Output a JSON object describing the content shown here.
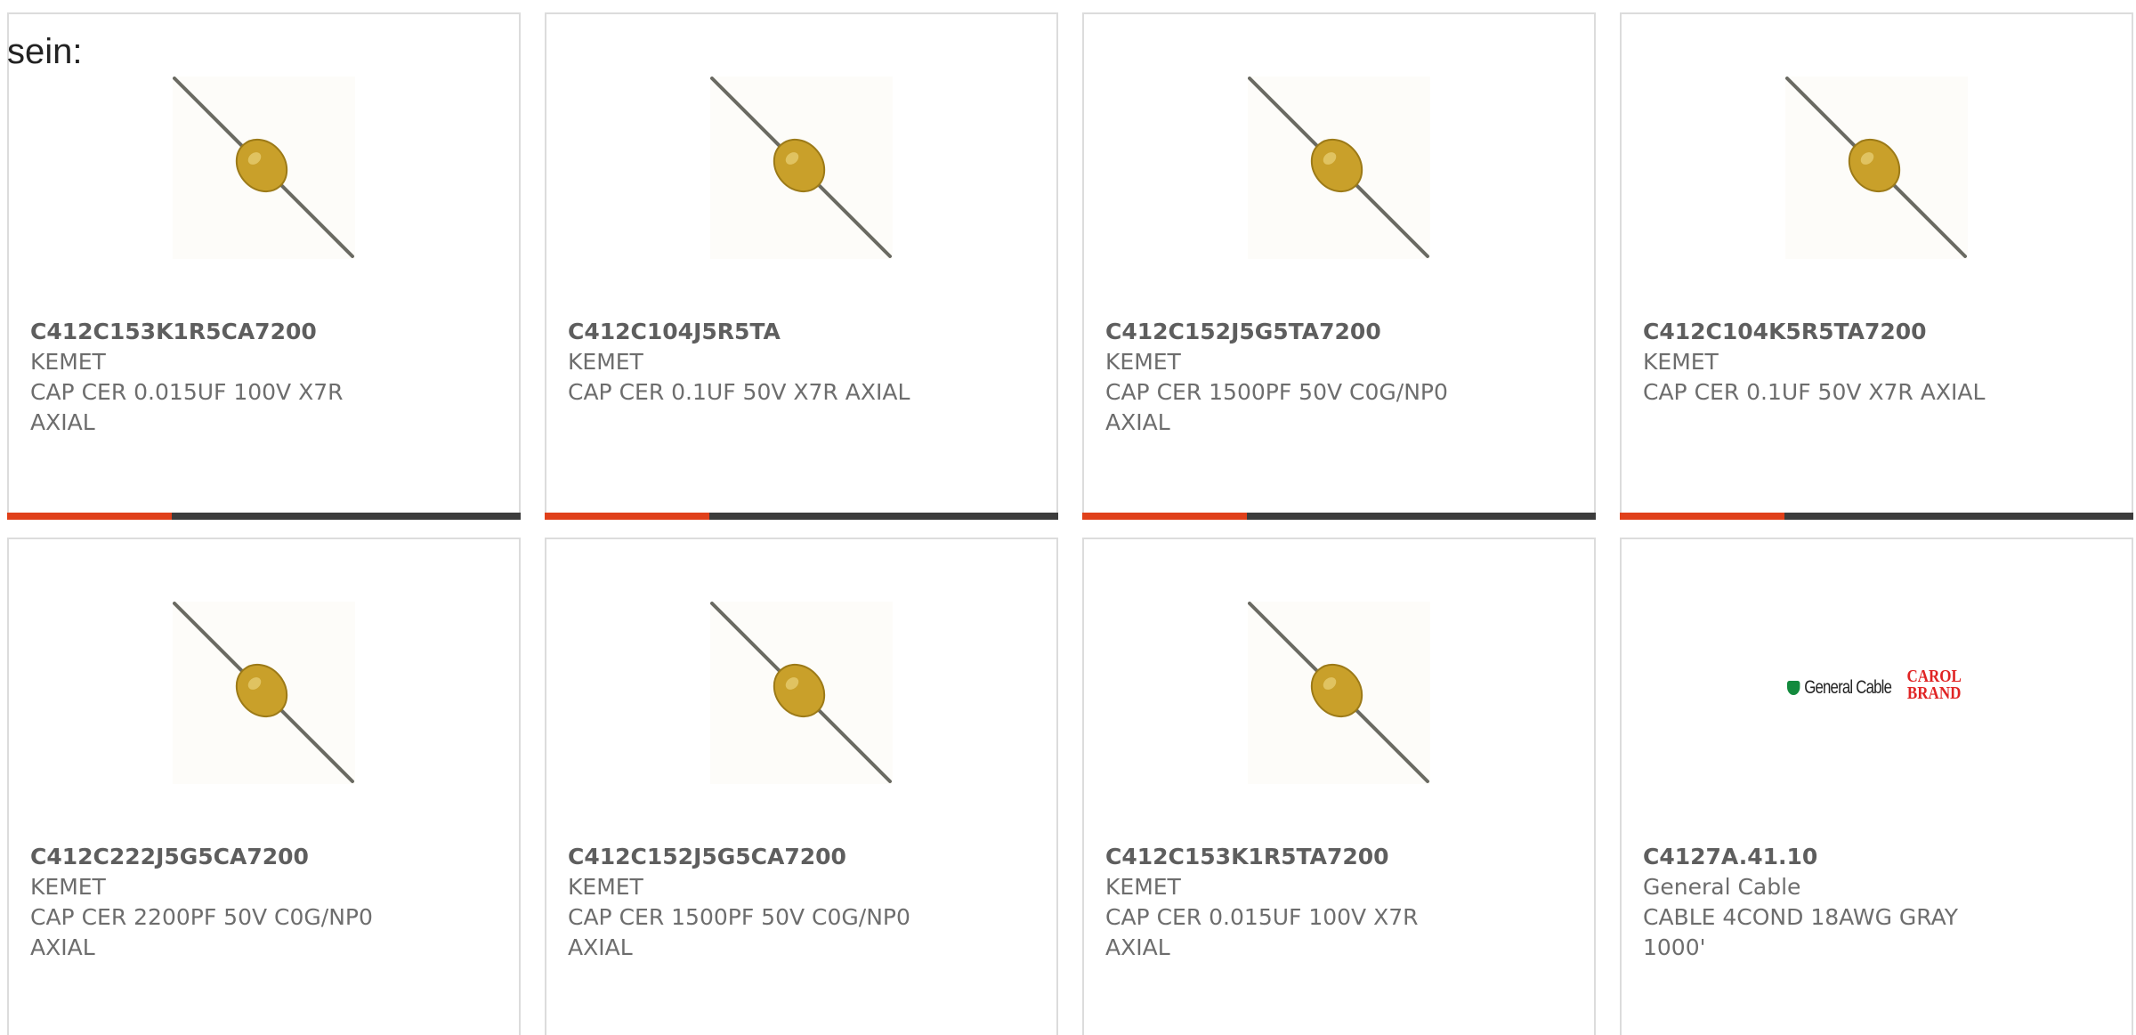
{
  "lead_text": "sein:",
  "colors": {
    "bar_accent": "#e0401a",
    "bar_track": "#3c3c3c",
    "card_border": "#dcdcdc",
    "capacitor_body": "#c9a02a"
  },
  "products": [
    {
      "part_number": "C412C153K1R5CA7200",
      "manufacturer": "KEMET",
      "description": "CAP CER 0.015UF 100V X7R AXIAL",
      "image": "axial-capacitor-image",
      "bar_fill_fraction": 0.32
    },
    {
      "part_number": "C412C104J5R5TA",
      "manufacturer": "KEMET",
      "description": "CAP CER 0.1UF 50V X7R AXIAL",
      "image": "axial-capacitor-image",
      "bar_fill_fraction": 0.32
    },
    {
      "part_number": "C412C152J5G5TA7200",
      "manufacturer": "KEMET",
      "description": "CAP CER 1500PF 50V C0G/NP0 AXIAL",
      "image": "axial-capacitor-image",
      "bar_fill_fraction": 0.32
    },
    {
      "part_number": "C412C104K5R5TA7200",
      "manufacturer": "KEMET",
      "description": "CAP CER 0.1UF 50V X7R AXIAL",
      "image": "axial-capacitor-image",
      "bar_fill_fraction": 0.32
    },
    {
      "part_number": "C412C222J5G5CA7200",
      "manufacturer": "KEMET",
      "description": "CAP CER 2200PF 50V C0G/NP0 AXIAL",
      "image": "axial-capacitor-image"
    },
    {
      "part_number": "C412C152J5G5CA7200",
      "manufacturer": "KEMET",
      "description": "CAP CER 1500PF 50V C0G/NP0 AXIAL",
      "image": "axial-capacitor-image"
    },
    {
      "part_number": "C412C153K1R5TA7200",
      "manufacturer": "KEMET",
      "description": "CAP CER 0.015UF 100V X7R AXIAL",
      "image": "axial-capacitor-image"
    },
    {
      "part_number": "C4127A.41.10",
      "manufacturer": "General Cable",
      "description": "CABLE 4COND 18AWG GRAY 1000'",
      "image": "general-cable-carol-brand-logo",
      "logo_text_primary": "General Cable",
      "logo_text_secondary": "CAROL BRAND"
    }
  ]
}
